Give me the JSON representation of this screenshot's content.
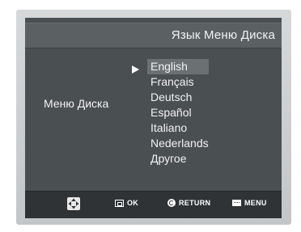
{
  "header": {
    "title": "Язык Меню Диска"
  },
  "setting": {
    "label": "Меню Диска"
  },
  "languages": {
    "selected_index": 0,
    "items": [
      {
        "label": "English"
      },
      {
        "label": "Français"
      },
      {
        "label": "Deutsch"
      },
      {
        "label": "Español"
      },
      {
        "label": "Italiano"
      },
      {
        "label": "Nederlands"
      },
      {
        "label": "Другое"
      }
    ]
  },
  "footer": {
    "nav_icon": "dpad-icon",
    "ok_label": "OK",
    "return_label": "RETURN",
    "menu_label": "MENU"
  },
  "colors": {
    "screen_bg": "#4a4f52",
    "highlight": "#6b7073",
    "footer_bg": "#2f3336"
  }
}
